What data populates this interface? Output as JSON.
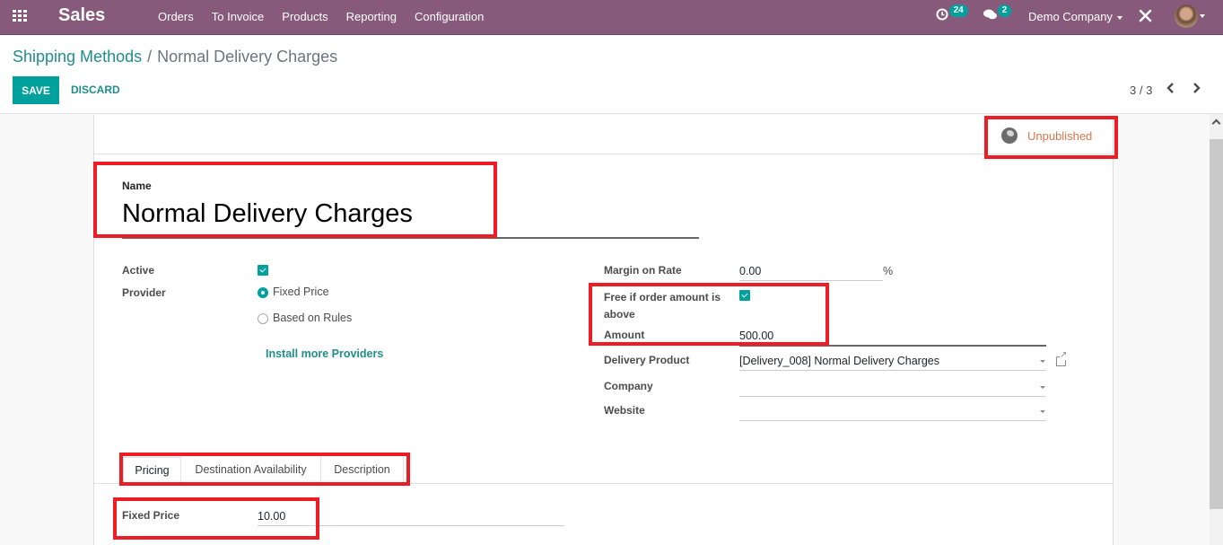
{
  "navbar": {
    "app_name": "Sales",
    "menu": [
      "Orders",
      "To Invoice",
      "Products",
      "Reporting",
      "Configuration"
    ],
    "activity_count": "24",
    "messages_count": "2",
    "company": "Demo Company",
    "icons": {
      "apps": "apps-grid-icon",
      "activity": "clock-icon",
      "messages": "chat-icon",
      "debug": "tools-icon",
      "user": "user-avatar"
    }
  },
  "control_panel": {
    "breadcrumb_parent": "Shipping Methods",
    "breadcrumb_separator": "/",
    "breadcrumb_current": "Normal Delivery Charges",
    "save_label": "SAVE",
    "discard_label": "DISCARD",
    "pager": "3 / 3"
  },
  "form": {
    "publish_status": "Unpublished",
    "name_label": "Name",
    "name_value": "Normal Delivery Charges",
    "left": {
      "active_label": "Active",
      "active_checked": true,
      "provider_label": "Provider",
      "provider_options": [
        "Fixed Price",
        "Based on Rules"
      ],
      "provider_selected": "Fixed Price",
      "install_link": "Install more Providers"
    },
    "right": {
      "margin_label": "Margin on Rate",
      "margin_value": "0.00",
      "margin_unit": "%",
      "free_label": "Free if order amount is above",
      "free_checked": true,
      "amount_label": "Amount",
      "amount_value": "500.00",
      "delivery_product_label": "Delivery Product",
      "delivery_product_value": "[Delivery_008] Normal Delivery Charges",
      "company_label": "Company",
      "company_value": "",
      "website_label": "Website",
      "website_value": ""
    },
    "tabs": [
      "Pricing",
      "Destination Availability",
      "Description"
    ],
    "active_tab": "Pricing",
    "pricing": {
      "fixed_price_label": "Fixed Price",
      "fixed_price_value": "10.00"
    }
  },
  "colors": {
    "navbar": "#875a7b",
    "primary": "#00a09d",
    "link": "#1f8e8c",
    "unpublished": "#d9784c",
    "highlight": "#ee1c25"
  }
}
